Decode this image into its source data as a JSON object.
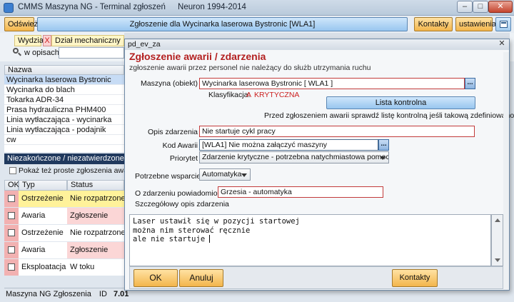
{
  "window": {
    "title": "CMMS Maszyna NG - Terminal zgłoszeń",
    "subtitle": "Neuron 1994-2014"
  },
  "toolbar": {
    "refresh_label": "Odśwież",
    "report_for_label": "Zgłoszenie dla Wycinarka laserowa Bystronic [WLA1]",
    "contacts_label": "Kontakty",
    "settings_label": "ustawienia"
  },
  "filter": {
    "department_label": "Wydział",
    "department_clear": "X",
    "department_value": "Dział mechaniczny",
    "search_label": "w opisach",
    "search_value": ""
  },
  "machines": {
    "header": "Nazwa",
    "items": [
      "Wycinarka laserowa Bystronic",
      "Wycinarka do blach",
      "Tokarka ADR-34",
      "Prasa hydrauliczna PHM400",
      "Linia wytłaczająca - wycinarka",
      "Linia wytłaczająca - podajnik",
      "cw"
    ]
  },
  "reports": {
    "section_title": "Niezakończone / niezatwierdzone awarie",
    "show_simple_label": "Pokaż też proste zgłoszenia awarii",
    "columns": [
      "OK",
      "Typ",
      "Status"
    ],
    "rows": [
      {
        "typ": "Ostrzeżenie",
        "status": "Nie rozpatrzone"
      },
      {
        "typ": "Awaria",
        "status": "Zgłoszenie"
      },
      {
        "typ": "Ostrzeżenie",
        "status": "Nie rozpatrzone"
      },
      {
        "typ": "Awaria",
        "status": "Zgłoszenie"
      },
      {
        "typ": "Eksploatacja",
        "status": "W toku"
      }
    ]
  },
  "statusbar": {
    "app": "Maszyna NG Zgłoszenia",
    "id_label": "ID",
    "id_value": "7.01"
  },
  "dialog": {
    "window_name": "pd_ev_za",
    "heading": "Zgłoszenie awarii / zdarzenia",
    "subheading": "zgłoszenie awarii przez personel nie należący do służb utrzymania ruchu",
    "machine_label": "Maszyna (obiekt)",
    "machine_value": "Wycinarka laserowa Bystronic [ WLA1 ]",
    "dots": "...",
    "classification_label": "Klasyfikacja:",
    "classification_letter": "A",
    "classification_value": "KRYTYCZNA",
    "checklist_button": "Lista kontrolna",
    "checklist_hint": "Przed zgłoszeniem awarii sprawdź listę kontrolną jeśli takową zdefiniowano",
    "event_desc_label": "Opis zdarzenia",
    "event_desc_value": "Nie startuje cykl pracy",
    "fault_code_label": "Kod Awarii",
    "fault_code_value": "[WLA1] Nie można załączyć maszyny",
    "priority_label": "Priorytet",
    "priority_value": "Zdarzenie krytyczne - potrzebna natychmiastowa pomoc",
    "support_label": "Potrzebne wsparcie",
    "support_value": "Automatyka",
    "notified_label": "O zdarzeniu powiadomiono",
    "notified_value": "Grzesia - automatyka",
    "details_label": "Szczegółowy opis zdarzenia",
    "details_lines": [
      "Laser ustawił się w pozycji startowej",
      "można nim sterować ręcznie",
      "ale nie startuje "
    ],
    "ok_label": "OK",
    "cancel_label": "Anuluj",
    "contacts_label": "Kontakty"
  }
}
